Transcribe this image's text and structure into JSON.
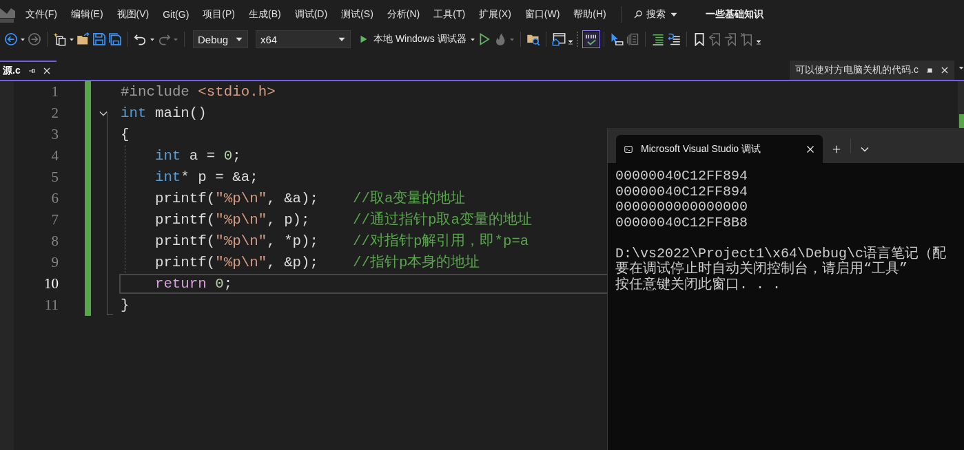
{
  "menu": [
    "文件(F)",
    "编辑(E)",
    "视图(V)",
    "Git(G)",
    "项目(P)",
    "生成(B)",
    "调试(D)",
    "测试(S)",
    "分析(N)",
    "工具(T)",
    "扩展(X)",
    "窗口(W)",
    "帮助(H)"
  ],
  "search": {
    "label": "搜索"
  },
  "solution": "一些基础知识",
  "toolbar": [
    {
      "kind": "back",
      "disabled": false
    },
    {
      "kind": "caret",
      "disabled": false
    },
    {
      "kind": "forward",
      "disabled": true
    },
    {
      "kind": "sep"
    },
    {
      "kind": "new-item",
      "disabled": false
    },
    {
      "kind": "caret",
      "disabled": false
    },
    {
      "kind": "open",
      "disabled": false
    },
    {
      "kind": "save",
      "disabled": false
    },
    {
      "kind": "save-all",
      "disabled": false
    },
    {
      "kind": "sep"
    },
    {
      "kind": "undo",
      "disabled": false
    },
    {
      "kind": "caret",
      "disabled": false
    },
    {
      "kind": "redo",
      "disabled": true
    },
    {
      "kind": "caret",
      "disabled": true
    },
    {
      "kind": "sep"
    },
    {
      "kind": "config-combo",
      "value": "Debug"
    },
    {
      "kind": "platform-combo",
      "value": "x64"
    },
    {
      "kind": "run",
      "label": "本地 Windows 调试器"
    },
    {
      "kind": "caret",
      "disabled": false
    },
    {
      "kind": "run-outline",
      "disabled": false
    },
    {
      "kind": "flame",
      "disabled": true
    },
    {
      "kind": "caret",
      "disabled": true
    },
    {
      "kind": "sep"
    },
    {
      "kind": "find-folder",
      "disabled": false
    },
    {
      "kind": "sep"
    },
    {
      "kind": "window-home",
      "disabled": false
    },
    {
      "kind": "overflow"
    },
    {
      "kind": "grip"
    },
    {
      "kind": "spell-check",
      "disabled": false,
      "on": true
    },
    {
      "kind": "sep"
    },
    {
      "kind": "pointer",
      "disabled": false
    },
    {
      "kind": "stack",
      "disabled": true
    },
    {
      "kind": "sep"
    },
    {
      "kind": "indent",
      "disabled": false
    },
    {
      "kind": "comment-lines",
      "disabled": false
    },
    {
      "kind": "sep"
    },
    {
      "kind": "bookmark",
      "disabled": false
    },
    {
      "kind": "bookmark-prev",
      "disabled": true
    },
    {
      "kind": "bookmark-next",
      "disabled": true
    },
    {
      "kind": "bookmark-clear",
      "disabled": true
    },
    {
      "kind": "overflow"
    }
  ],
  "documents": [
    {
      "label": "源.c",
      "selected": true
    },
    {
      "label": "可以使对方电脑关机的代码.c",
      "selected": false
    }
  ],
  "editor": {
    "lines": [
      {
        "number": "1",
        "fold": false,
        "current": false,
        "tokens": [
          {
            "kind": "preproc",
            "text": "#include"
          },
          {
            "kind": "include",
            "text": " <stdio.h>"
          }
        ]
      },
      {
        "number": "2",
        "fold": true,
        "current": false,
        "tokens": [
          {
            "kind": "keyword",
            "text": "int"
          },
          {
            "kind": "plain",
            "text": " main()"
          }
        ]
      },
      {
        "number": "3",
        "fold": false,
        "current": false,
        "tokens": [
          {
            "kind": "plain",
            "text": "{"
          }
        ],
        "children": [
          {
            "number": "4",
            "fold": false,
            "current": false,
            "tokens": [
              {
                "kind": "keyword",
                "text": "int"
              },
              {
                "kind": "plain",
                "text": " a = "
              },
              {
                "kind": "number",
                "text": "0"
              },
              {
                "kind": "plain",
                "text": ";"
              }
            ]
          },
          {
            "number": "5",
            "fold": false,
            "current": false,
            "tokens": [
              {
                "kind": "keyword",
                "text": "int"
              },
              {
                "kind": "plain",
                "text": "* p = &a;"
              }
            ]
          },
          {
            "number": "6",
            "fold": false,
            "current": false,
            "tokens": [
              {
                "kind": "plain",
                "text": "printf("
              },
              {
                "kind": "string",
                "text": "\"%p\\n\""
              },
              {
                "kind": "plain",
                "text": ", &a);    "
              },
              {
                "kind": "comment",
                "text": "//取a变量的地址"
              }
            ]
          },
          {
            "number": "7",
            "fold": false,
            "current": false,
            "tokens": [
              {
                "kind": "plain",
                "text": "printf("
              },
              {
                "kind": "string",
                "text": "\"%p\\n\""
              },
              {
                "kind": "plain",
                "text": ", p);     "
              },
              {
                "kind": "comment",
                "text": "//通过指针p取a变量的地址"
              }
            ]
          },
          {
            "number": "8",
            "fold": false,
            "current": false,
            "tokens": [
              {
                "kind": "plain",
                "text": "printf("
              },
              {
                "kind": "string",
                "text": "\"%p\\n\""
              },
              {
                "kind": "plain",
                "text": ", *p);    "
              },
              {
                "kind": "comment",
                "text": "//对指针p解引用，即*p=a"
              }
            ]
          },
          {
            "number": "9",
            "fold": false,
            "current": false,
            "tokens": [
              {
                "kind": "plain",
                "text": "printf("
              },
              {
                "kind": "string",
                "text": "\"%p\\n\""
              },
              {
                "kind": "plain",
                "text": ", &p);    "
              },
              {
                "kind": "comment",
                "text": "//指针p本身的地址"
              }
            ]
          },
          {
            "number": "10",
            "fold": false,
            "current": true,
            "tokens": [
              {
                "kind": "control",
                "text": "return"
              },
              {
                "kind": "number",
                "text": " 0"
              },
              {
                "kind": "plain",
                "text": ";"
              }
            ]
          }
        ]
      },
      {
        "number": "11",
        "fold": false,
        "current": false,
        "tokens": [
          {
            "kind": "plain",
            "text": "}"
          }
        ]
      }
    ]
  },
  "console": {
    "title": "Microsoft Visual Studio 调试",
    "output": [
      "00000040C12FF894",
      "00000040C12FF894",
      "0000000000000000",
      "00000040C12FF8B8"
    ],
    "messages": [
      "D:\\vs2022\\Project1\\x64\\Debug\\c语言笔记（配",
      "要在调试停止时自动关闭控制台，请启用“工具”",
      "按任意键关闭此窗口. . ."
    ]
  }
}
